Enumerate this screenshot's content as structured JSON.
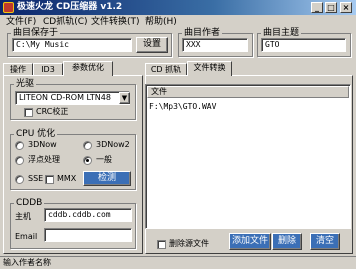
{
  "window": {
    "title": "极速火龙 CD压缩器 v1.2"
  },
  "menu": [
    {
      "label": "文件(F)"
    },
    {
      "label": "CD抓轨(C)"
    },
    {
      "label": "文件转换(T)"
    },
    {
      "label": "帮助(H)"
    }
  ],
  "output": {
    "label": "曲目保存于",
    "value": "C:\\My Music",
    "set_button": "设置"
  },
  "artist": {
    "label": "曲目作者",
    "value": "XXX"
  },
  "subject": {
    "label": "曲目主题",
    "value": "GTO"
  },
  "left_tabs": [
    {
      "label": "操作"
    },
    {
      "label": "ID3"
    },
    {
      "label": "参数优化"
    }
  ],
  "drive": {
    "label": "光驱",
    "value": "LITEON  CD-ROM LTN48",
    "crc_label": "CRC校正"
  },
  "cpu": {
    "label": "CPU 优化",
    "options": [
      "3DNow",
      "3DNow2",
      "浮点处理",
      "一般",
      "SSE",
      "MMX"
    ],
    "selected": "一般",
    "detect_button": "检测"
  },
  "cddb": {
    "label": "CDDB",
    "host_label": "主机",
    "host_value": "cddb.cddb.com",
    "email_label": "Email",
    "email_value": ""
  },
  "right_tabs": [
    {
      "label": "CD 抓轨"
    },
    {
      "label": "文件转换"
    }
  ],
  "file_list": {
    "column_header": "文件",
    "rows": [
      "F:\\Mp3\\GTO.WAV"
    ]
  },
  "bottom": {
    "delete_source_label": "删除源文件",
    "add_button": "添加文件",
    "delete_button": "删除",
    "clear_button": "清空"
  },
  "status": {
    "text": "输入作者名称"
  }
}
